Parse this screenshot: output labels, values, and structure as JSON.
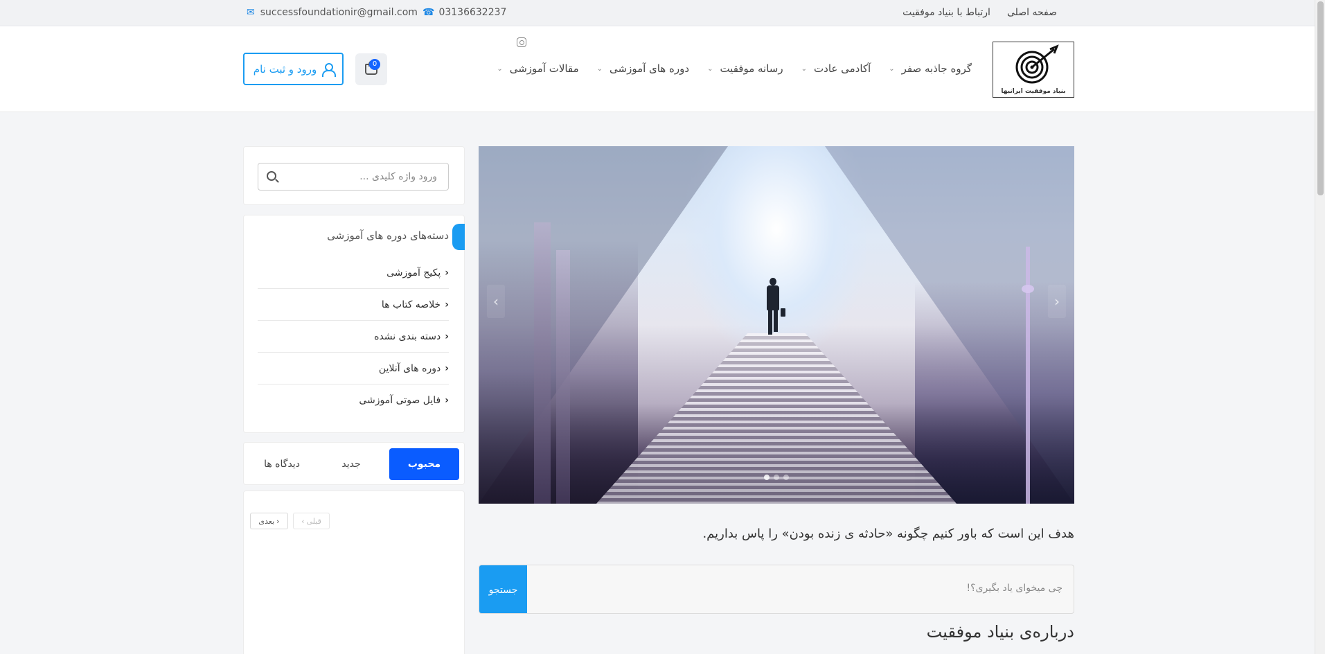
{
  "topbar": {
    "email": "successfoundationir@gmail.com",
    "phone": "03136632237",
    "links": [
      "صفحه اصلی",
      "ارتباط با بنیاد موفقیت"
    ]
  },
  "header": {
    "logo_text": "بنیاد موفقیت ایرانیها",
    "nav": [
      "گروه جاذبه صفر",
      "آکادمی عادت",
      "رسانه موفقیت",
      "دوره های آموزشی",
      "مقالات آموزشی"
    ],
    "cart_count": "0",
    "login_label": "ورود و ثبت نام"
  },
  "sidebar": {
    "search_placeholder": "ورود واژه کلیدی ...",
    "categories_title": "دسته‌های دوره های آموزشی",
    "categories": [
      "پکیج آموزشی",
      "خلاصه کتاب ها",
      "دسته بندی نشده",
      "دوره های آنلاین",
      "فایل صوتی آموزشی"
    ],
    "tabs": [
      "محبوب",
      "جدید",
      "دیدگاه ها"
    ],
    "pager": {
      "next": "بعدی",
      "prev": "قبلی"
    }
  },
  "main": {
    "tagline": "هدف این است که باور کنیم چگونه «حادثه ی زنده بودن» را پاس بداریم.",
    "search_placeholder": "چی میخوای یاد بگیری؟!",
    "search_button": "جستجو",
    "about_title": "درباره‌ی بنیاد موفقیت"
  },
  "colors": {
    "accent": "#1a9cf2",
    "primary": "#0a5cff"
  },
  "icons": [
    "mail-icon",
    "phone-icon",
    "instagram-icon",
    "cart-icon",
    "user-icon",
    "search-icon",
    "chevron-down-icon",
    "chevron-left-icon",
    "chevron-right-icon"
  ]
}
